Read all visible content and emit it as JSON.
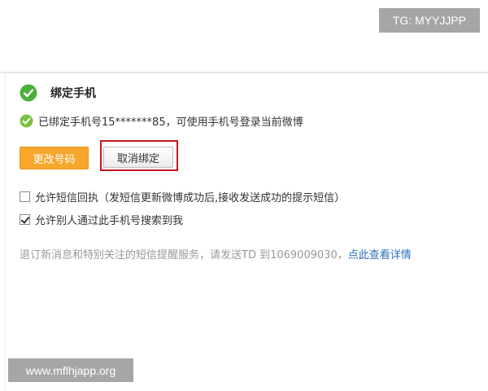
{
  "watermarks": {
    "top": "TG: MYYJJPP",
    "bottom": "www.mflhjapp.org"
  },
  "section": {
    "title": "绑定手机"
  },
  "bound_status": {
    "text": "已绑定手机号15*******85，可使用手机号登录当前微博"
  },
  "buttons": {
    "change_number": "更改号码",
    "unbind": "取消绑定"
  },
  "options": [
    {
      "label": "允许短信回执（发短信更新微博成功后,接收发送成功的提示短信）",
      "checked": false
    },
    {
      "label": "允许别人通过此手机号搜索到我",
      "checked": true
    }
  ],
  "notice": {
    "text": "退订新消息和特别关注的短信提醒服务，请发送TD 到1069009030，",
    "link": "点此查看详情"
  },
  "colors": {
    "accent_orange": "#f7a72c",
    "check_green": "#4caf3c",
    "highlight_red": "#c8161d",
    "link_blue": "#2a6fb5"
  },
  "icons": {
    "title_check": "check-circle-icon",
    "bound_check": "check-circle-icon",
    "highlight": "highlight-frame"
  }
}
